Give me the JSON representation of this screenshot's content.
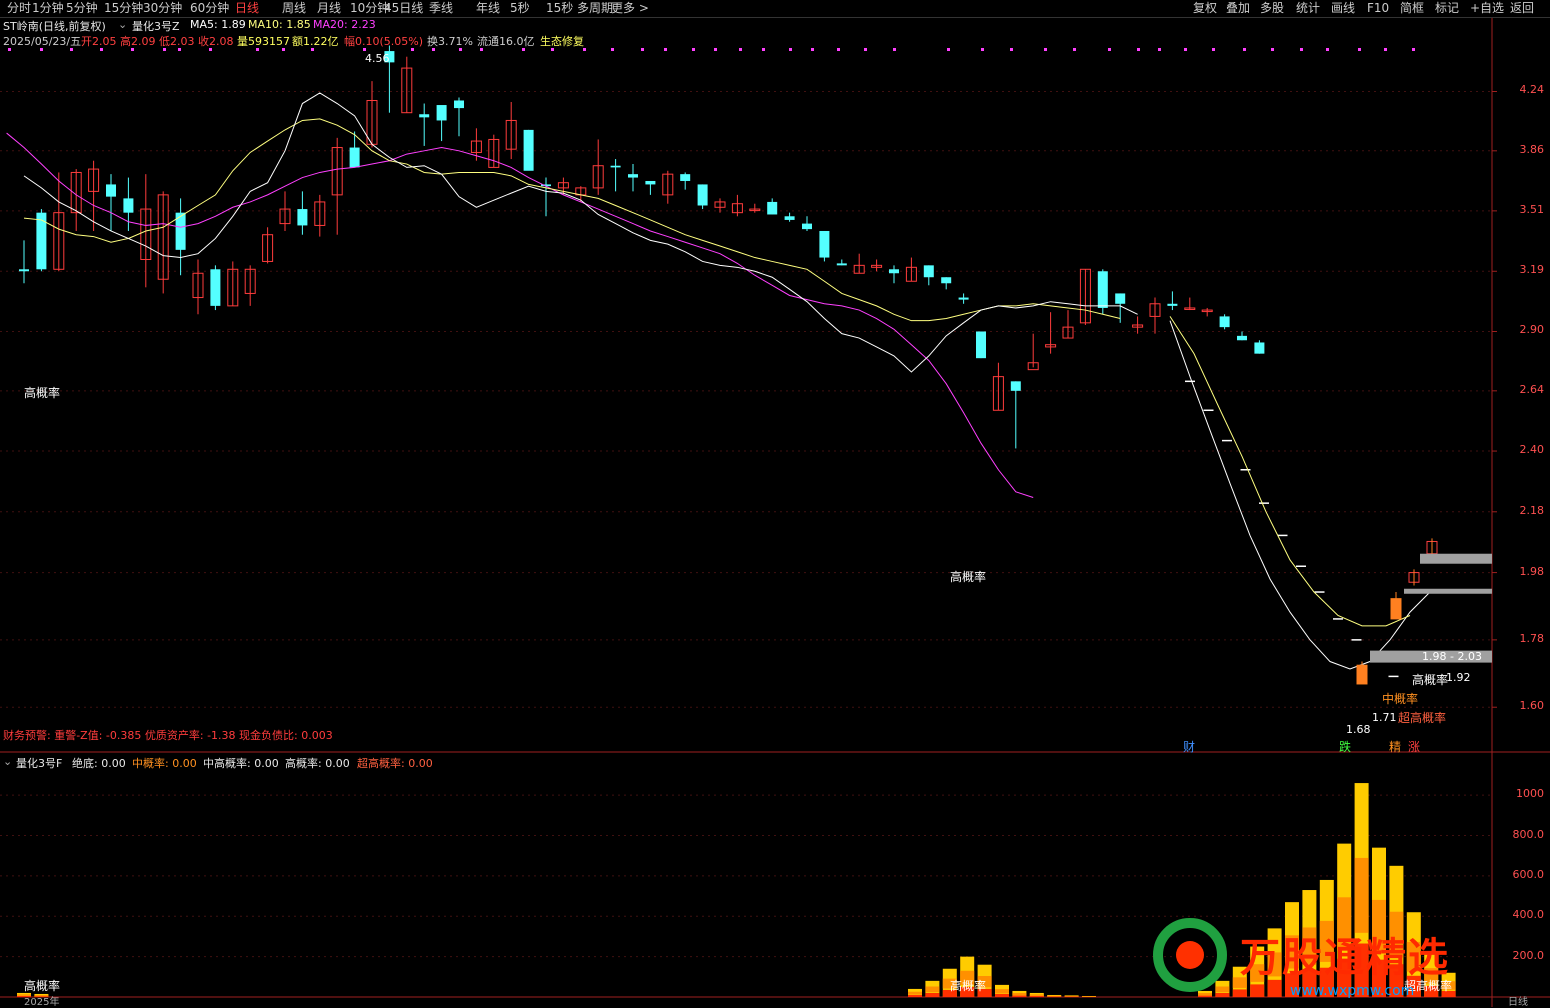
{
  "toolbar": {
    "left": [
      "分时",
      "1分钟",
      "5分钟",
      "15分钟",
      "30分钟",
      "60分钟",
      "日线",
      "周线",
      "月线",
      "10分钟",
      "45日线",
      "季线",
      "年线",
      "5秒",
      "15秒",
      "多周期",
      "更多 >"
    ],
    "active": "日线",
    "right": [
      "复权",
      "叠加",
      "多股",
      "统计",
      "画线",
      "F10",
      "简框",
      "标记",
      "+自选",
      "返回"
    ]
  },
  "header": {
    "stock": "ST岭南(日线,前复权)",
    "indicator": "量化3号Z",
    "ma5": "MA5: 1.89",
    "ma10": "MA10: 1.85",
    "ma20": "MA20: 2.23",
    "date": "2025/05/23/五",
    "open": "开2.05",
    "high": "高2.09",
    "low": "低2.03",
    "close": "收2.08",
    "volume": "量593157",
    "amount": "额1.22亿",
    "change": "幅0.10(5.05%)",
    "turnover": "换3.71%",
    "float": "流通16.0亿",
    "concept": "生态修复"
  },
  "finance_warning": "财务预警: 重警-Z值: -0.385 优质资产率: -1.38 现金负债比: 0.003",
  "sub_header": {
    "name": "量化3号F",
    "jd": "绝底: 0.00",
    "zhong": "中概率: 0.00",
    "zhonggao": "中高概率: 0.00",
    "gao": "高概率: 0.00",
    "chaogao": "超高概率: 0.00"
  },
  "labels": {
    "gao1": "高概率",
    "gao2": "高概率",
    "peak": "4.56",
    "range": "1.98 - 2.03",
    "val192": "1.92",
    "val171": "1.71",
    "val168": "1.68",
    "zhonggai": "中概率",
    "gao3": "高概率",
    "chaogao": "超高概率",
    "cai": "财",
    "die": "跌",
    "jing": "精",
    "zhang": "涨",
    "sub_gao1": "高概率",
    "sub_gao2": "高概率",
    "sub_chaogao": "超高概率",
    "bottom_date": "2025年",
    "bottom_right": "日线"
  },
  "axis_main": [
    "4.24",
    "3.86",
    "3.51",
    "3.19",
    "2.90",
    "2.64",
    "2.40",
    "2.18",
    "1.98",
    "1.78",
    "1.60"
  ],
  "axis_sub": [
    "1000",
    "800.0",
    "600.0",
    "400.0",
    "200.0"
  ],
  "watermark": "万股通精选",
  "watermark_url": "www.wxpmw.com",
  "colors": {
    "up": "#ff3c3c",
    "down": "#54ffff",
    "ma5": "#ffffff",
    "ma10": "#ffff80",
    "ma20": "#ff40ff"
  },
  "chart_data": {
    "type": "candlestick",
    "ylim": [
      1.5,
      4.6
    ],
    "y_scale": "log",
    "candles": [
      [
        3.2,
        3.19,
        3.35,
        3.13
      ],
      [
        3.5,
        3.2,
        3.52,
        3.19
      ],
      [
        3.2,
        3.5,
        3.73,
        3.19
      ],
      [
        3.5,
        3.73,
        3.75,
        3.4
      ],
      [
        3.62,
        3.75,
        3.8,
        3.4
      ],
      [
        3.66,
        3.59,
        3.72,
        3.4
      ],
      [
        3.58,
        3.5,
        3.7,
        3.4
      ],
      [
        3.25,
        3.52,
        3.72,
        3.11
      ],
      [
        3.15,
        3.6,
        3.62,
        3.08
      ],
      [
        3.5,
        3.3,
        3.58,
        3.17
      ],
      [
        3.06,
        3.18,
        3.25,
        2.98
      ],
      [
        3.2,
        3.02,
        3.22,
        3.0
      ],
      [
        3.02,
        3.2,
        3.24,
        3.02
      ],
      [
        3.08,
        3.2,
        3.22,
        3.02
      ],
      [
        3.24,
        3.38,
        3.42,
        3.23
      ],
      [
        3.44,
        3.52,
        3.62,
        3.4
      ],
      [
        3.52,
        3.43,
        3.62,
        3.38
      ],
      [
        3.43,
        3.56,
        3.6,
        3.37
      ],
      [
        3.6,
        3.88,
        3.94,
        3.38
      ],
      [
        3.88,
        3.76,
        3.98,
        3.76
      ],
      [
        3.9,
        4.18,
        4.31,
        3.88
      ],
      [
        4.52,
        4.44,
        4.56,
        4.1
      ],
      [
        4.1,
        4.4,
        4.48,
        4.1
      ],
      [
        4.09,
        4.07,
        4.16,
        3.89
      ],
      [
        4.15,
        4.05,
        4.11,
        3.92
      ],
      [
        4.18,
        4.13,
        4.2,
        3.95
      ],
      [
        3.85,
        3.92,
        4.0,
        3.8
      ],
      [
        3.76,
        3.93,
        3.96,
        3.76
      ],
      [
        3.87,
        4.05,
        4.17,
        3.81
      ],
      [
        3.99,
        3.74,
        3.99,
        3.76
      ],
      [
        3.66,
        3.65,
        3.7,
        3.48
      ],
      [
        3.64,
        3.67,
        3.7,
        3.6
      ],
      [
        3.6,
        3.64,
        3.65,
        3.56
      ],
      [
        3.64,
        3.77,
        3.93,
        3.6
      ],
      [
        3.77,
        3.76,
        3.81,
        3.62
      ],
      [
        3.72,
        3.7,
        3.78,
        3.62
      ],
      [
        3.68,
        3.66,
        3.68,
        3.6
      ],
      [
        3.6,
        3.72,
        3.74,
        3.55
      ],
      [
        3.72,
        3.68,
        3.73,
        3.63
      ],
      [
        3.66,
        3.54,
        3.66,
        3.52
      ],
      [
        3.53,
        3.56,
        3.58,
        3.5
      ],
      [
        3.5,
        3.55,
        3.6,
        3.48
      ],
      [
        3.52,
        3.52,
        3.55,
        3.5
      ],
      [
        3.56,
        3.49,
        3.58,
        3.49
      ],
      [
        3.48,
        3.46,
        3.5,
        3.45
      ],
      [
        3.44,
        3.41,
        3.48,
        3.4
      ],
      [
        3.4,
        3.26,
        3.4,
        3.24
      ],
      [
        3.23,
        3.22,
        3.25,
        3.22
      ],
      [
        3.18,
        3.22,
        3.28,
        3.18
      ],
      [
        3.21,
        3.22,
        3.25,
        3.19
      ],
      [
        3.2,
        3.18,
        3.22,
        3.13
      ],
      [
        3.14,
        3.21,
        3.26,
        3.14
      ],
      [
        3.22,
        3.16,
        3.22,
        3.12
      ],
      [
        3.16,
        3.13,
        3.16,
        3.1
      ],
      [
        3.06,
        3.05,
        3.08,
        3.03
      ],
      [
        2.9,
        2.78,
        2.9,
        2.78
      ],
      [
        2.56,
        2.7,
        2.76,
        2.56
      ],
      [
        2.68,
        2.64,
        2.68,
        2.41
      ],
      [
        2.73,
        2.76,
        2.89,
        2.74
      ],
      [
        2.83,
        2.84,
        2.99,
        2.8
      ],
      [
        2.87,
        2.92,
        3.0,
        2.87
      ],
      [
        2.94,
        3.2,
        3.2,
        2.93
      ],
      [
        3.19,
        3.01,
        3.2,
        2.98
      ],
      [
        3.08,
        3.03,
        3.08,
        2.94
      ],
      [
        2.92,
        2.93,
        2.97,
        2.89
      ],
      [
        2.97,
        3.03,
        3.06,
        2.89
      ],
      [
        3.03,
        3.02,
        3.09,
        3.0
      ],
      [
        3.01,
        3.01,
        3.06,
        3.0
      ],
      [
        3.0,
        3.0,
        3.01,
        2.97
      ],
      [
        2.97,
        2.92,
        2.98,
        2.91
      ],
      [
        2.88,
        2.86,
        2.9,
        2.86
      ],
      [
        2.85,
        2.8,
        2.86,
        2.8
      ]
    ],
    "ma5": [
      3.71,
      3.64,
      3.56,
      3.51,
      3.45,
      3.4,
      3.36,
      3.32,
      3.27,
      3.26,
      3.28,
      3.36,
      3.48,
      3.62,
      3.67,
      3.86,
      4.16,
      4.23,
      4.16,
      4.08,
      3.9,
      3.82,
      3.76,
      3.77,
      3.72,
      3.59,
      3.53,
      3.57,
      3.61,
      3.65,
      3.62,
      3.61,
      3.57,
      3.49,
      3.44,
      3.39,
      3.35,
      3.33,
      3.29,
      3.24,
      3.22,
      3.21,
      3.19,
      3.16,
      3.1,
      3.04,
      2.96,
      2.89,
      2.87,
      2.83,
      2.79,
      2.72,
      2.79,
      2.88,
      2.94,
      3.0,
      3.02,
      3.01,
      3.02,
      3.04,
      3.03,
      3.02,
      3.02,
      3.02,
      2.98
    ],
    "ma10": [
      3.47,
      3.46,
      3.41,
      3.38,
      3.37,
      3.34,
      3.36,
      3.4,
      3.42,
      3.48,
      3.54,
      3.6,
      3.74,
      3.85,
      3.92,
      3.99,
      4.05,
      4.06,
      4.02,
      3.96,
      3.86,
      3.8,
      3.78,
      3.73,
      3.72,
      3.73,
      3.73,
      3.73,
      3.71,
      3.66,
      3.64,
      3.62,
      3.6,
      3.58,
      3.54,
      3.5,
      3.46,
      3.42,
      3.38,
      3.35,
      3.32,
      3.29,
      3.26,
      3.24,
      3.22,
      3.2,
      3.14,
      3.08,
      3.05,
      3.02,
      2.98,
      2.95,
      2.95,
      2.96,
      2.98,
      3.0,
      3.02,
      3.02,
      3.03,
      3.02,
      3.01,
      3.0,
      2.98,
      2.96
    ],
    "ma20": [
      3.97,
      3.88,
      3.78,
      3.68,
      3.6,
      3.54,
      3.5,
      3.45,
      3.43,
      3.44,
      3.42,
      3.44,
      3.48,
      3.53,
      3.56,
      3.6,
      3.65,
      3.7,
      3.73,
      3.75,
      3.76,
      3.78,
      3.8,
      3.84,
      3.86,
      3.88,
      3.86,
      3.83,
      3.8,
      3.76,
      3.7,
      3.65,
      3.6,
      3.56,
      3.52,
      3.48,
      3.44,
      3.4,
      3.37,
      3.34,
      3.31,
      3.28,
      3.23,
      3.17,
      3.12,
      3.07,
      3.05,
      3.03,
      3.02,
      3.0,
      2.96,
      2.91,
      2.84,
      2.77,
      2.67,
      2.55,
      2.43,
      2.33,
      2.25,
      2.23
    ],
    "projection": [
      2.68,
      2.56,
      2.44,
      2.33,
      2.21,
      2.1,
      2.0,
      1.92,
      1.84,
      1.78,
      1.72,
      1.68
    ],
    "last_candles": [
      [
        1.66,
        1.71,
        1.72,
        1.66
      ],
      [
        1.84,
        1.9,
        1.92,
        1.84
      ],
      [
        1.95,
        1.98,
        1.99,
        1.94
      ],
      [
        2.04,
        2.08,
        2.09,
        2.03
      ]
    ],
    "volume": [
      {
        "name": "early",
        "values": [
          20,
          15
        ]
      },
      {
        "name": "mid",
        "values": [
          40,
          80,
          140,
          200,
          160,
          60,
          30,
          20,
          10,
          8,
          5
        ]
      },
      {
        "name": "late",
        "values": [
          30,
          80,
          150,
          250,
          340,
          470,
          530,
          580,
          760,
          1060,
          740,
          650,
          420,
          220,
          120
        ]
      }
    ]
  }
}
